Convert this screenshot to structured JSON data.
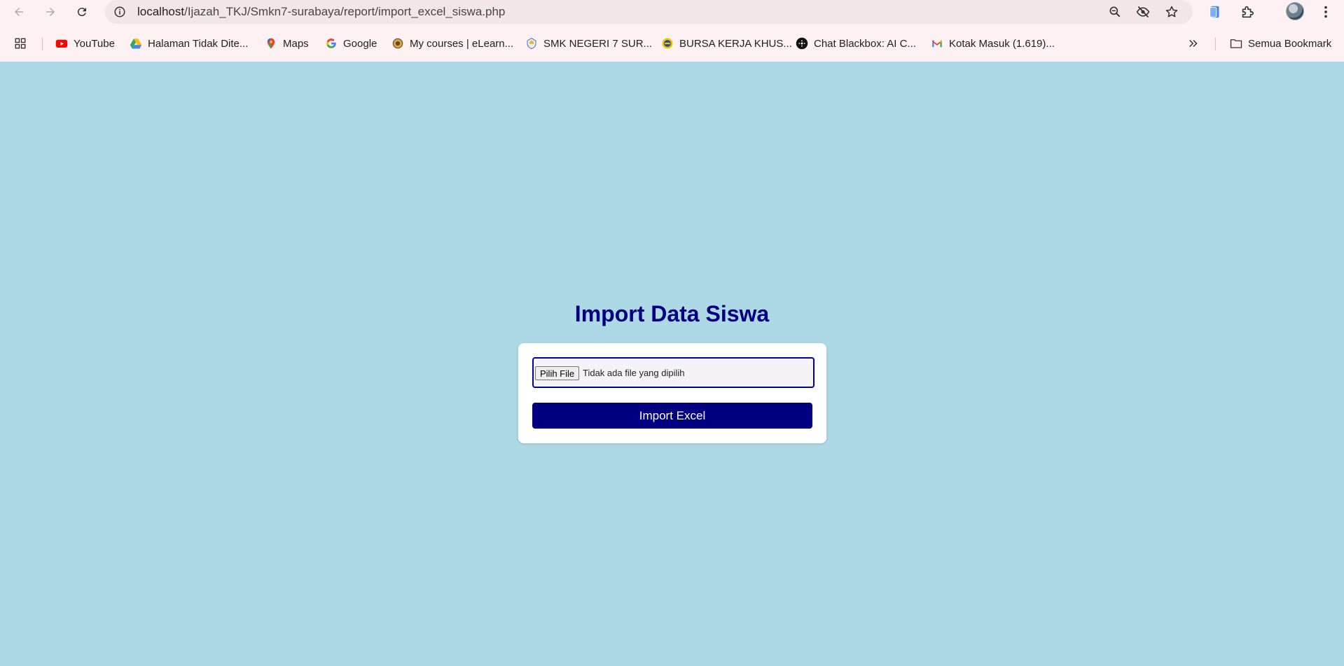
{
  "browser": {
    "url_host": "localhost",
    "url_path": "/Ijazah_TKJ/Smkn7-surabaya/report/import_excel_siswa.php",
    "bookmarks": [
      {
        "label": "YouTube",
        "icon": "youtube-icon"
      },
      {
        "label": "Halaman Tidak Dite...",
        "icon": "google-drive-icon"
      },
      {
        "label": "Maps",
        "icon": "google-maps-icon"
      },
      {
        "label": "Google",
        "icon": "google-icon"
      },
      {
        "label": "My courses | eLearn...",
        "icon": "elearning-icon"
      },
      {
        "label": "SMK NEGERI 7 SUR...",
        "icon": "school-icon"
      },
      {
        "label": "BURSA KERJA KHUS...",
        "icon": "bkk-icon"
      },
      {
        "label": "Chat Blackbox: AI C...",
        "icon": "blackbox-icon"
      },
      {
        "label": "Kotak Masuk (1.619)...",
        "icon": "gmail-icon"
      }
    ],
    "all_bookmarks_label": "Semua Bookmark"
  },
  "page": {
    "title": "Import Data Siswa",
    "file_button_label": "Pilih File",
    "file_status": "Tidak ada file yang dipilih",
    "submit_label": "Import Excel"
  },
  "colors": {
    "page_background": "#add8e6",
    "accent": "#000080",
    "chrome_background": "#fdf1f3"
  }
}
